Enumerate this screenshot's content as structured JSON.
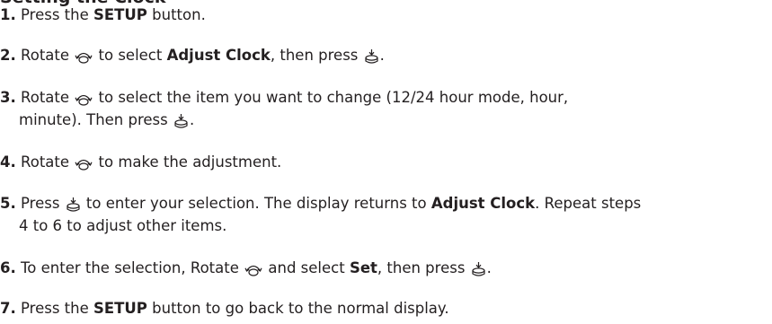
{
  "title": "Setting the Clock",
  "steps": [
    {
      "num": "1.",
      "a": "Press the ",
      "b": "SETUP",
      "c": " button."
    },
    {
      "num": "2.",
      "a": "Rotate ",
      "b": " to select ",
      "bold1": "Adjust Clock",
      "c": ", then press ",
      "d": "."
    },
    {
      "num": "3.",
      "a": "Rotate ",
      "b": " to select the item you want to change (12/24 hour mode, hour,",
      "line2a": "minute). Then press ",
      "line2b": "."
    },
    {
      "num": "4.",
      "a": "Rotate ",
      "b": " to make the adjustment."
    },
    {
      "num": "5.",
      "a": "Press ",
      "b": " to enter your selection. The display returns to ",
      "bold1": "Adjust Clock",
      "c": ". Repeat steps",
      "line2": "4 to 6 to adjust other items."
    },
    {
      "num": "6.",
      "a": "To enter the selection, Rotate ",
      "b": " and select ",
      "bold1": "Set",
      "c": ", then press ",
      "d": "."
    },
    {
      "num": "7.",
      "a": "Press the ",
      "b": "SETUP",
      "c": " button to go back to the normal display."
    }
  ],
  "icons": {
    "dial": "selector-knob-rotate-icon",
    "press": "selector-knob-press-icon"
  }
}
